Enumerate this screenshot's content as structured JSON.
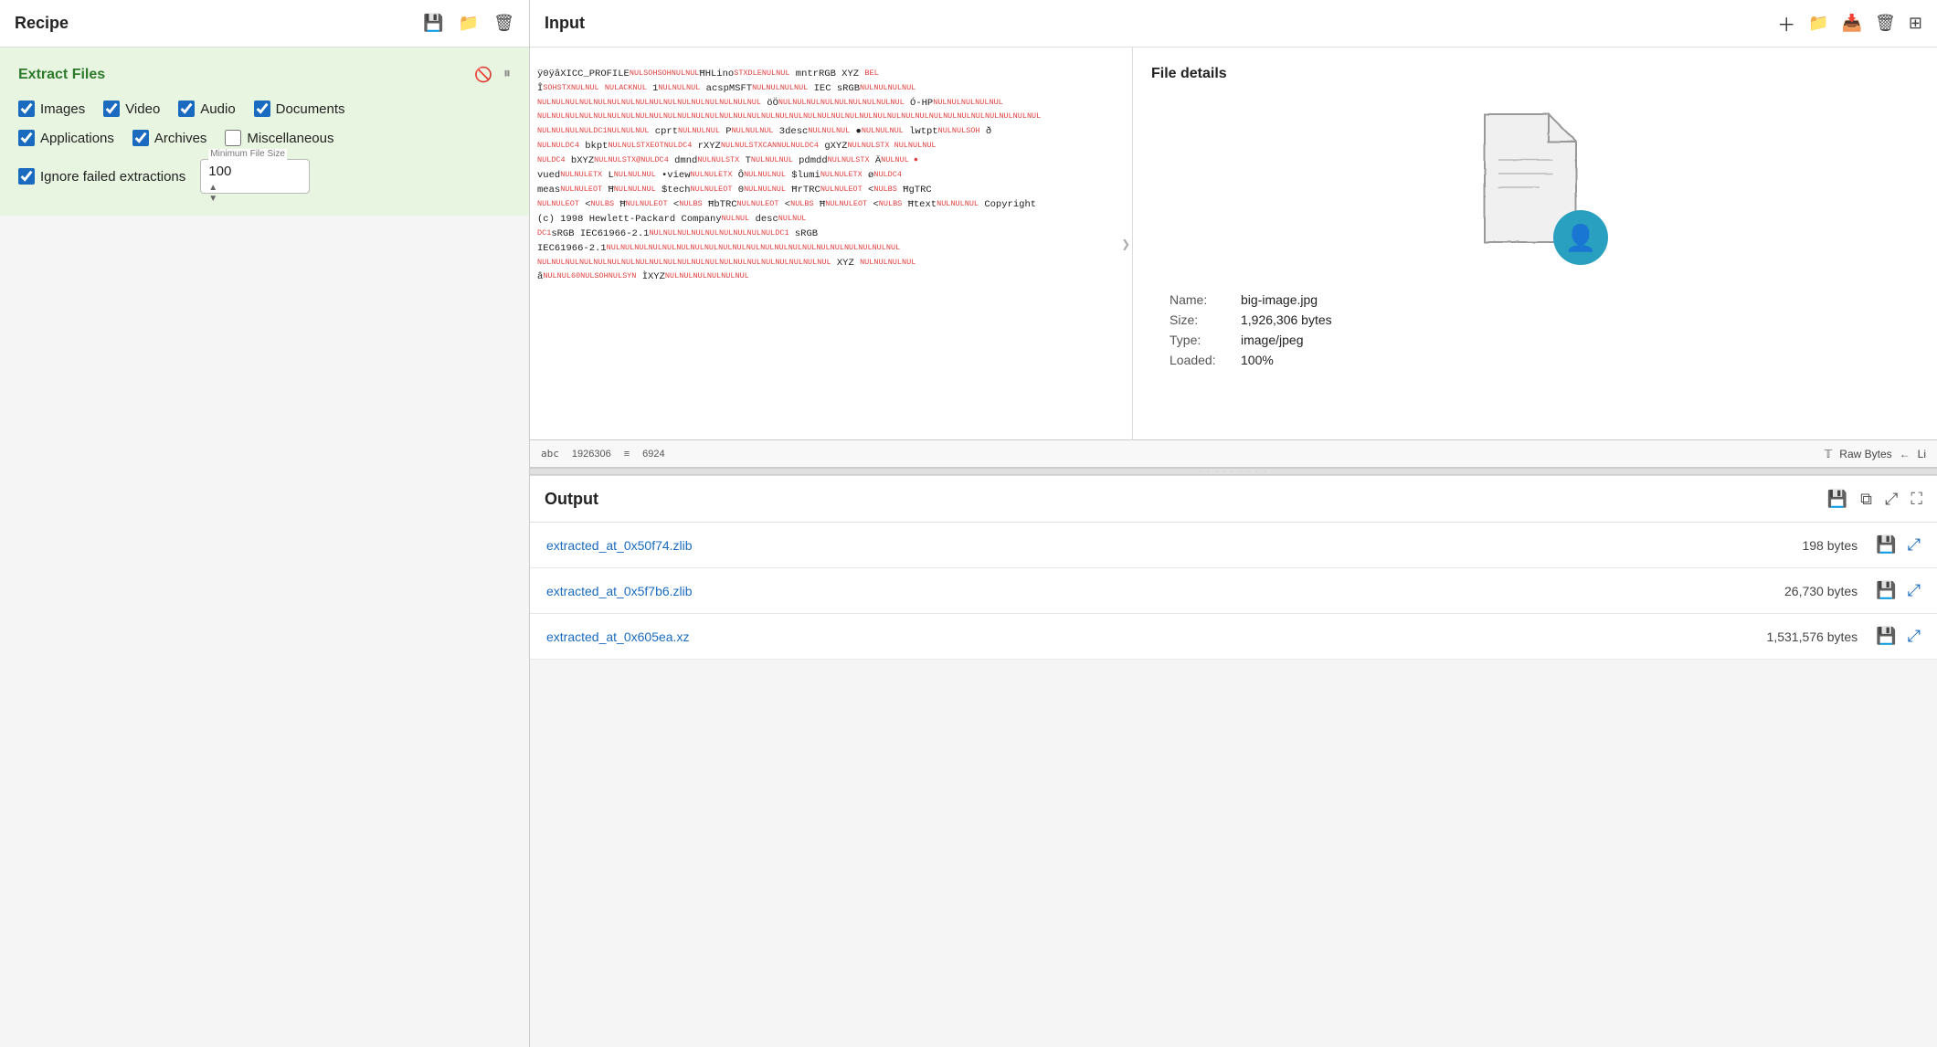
{
  "left_panel": {
    "title": "Recipe",
    "icons": [
      "save",
      "folder",
      "trash"
    ],
    "extract_files": {
      "title": "Extract Files",
      "checkboxes_row1": [
        {
          "label": "Images",
          "checked": true
        },
        {
          "label": "Video",
          "checked": true
        },
        {
          "label": "Audio",
          "checked": true
        },
        {
          "label": "Documents",
          "checked": true
        }
      ],
      "checkboxes_row2": [
        {
          "label": "Applications",
          "checked": true
        },
        {
          "label": "Archives",
          "checked": true
        },
        {
          "label": "Miscellaneous",
          "checked": false
        }
      ],
      "ignore_failed": {
        "label": "Ignore failed extractions",
        "checked": true
      },
      "min_file_size": {
        "label": "Minimum File Size",
        "value": "100"
      }
    }
  },
  "right_panel": {
    "input_title": "Input",
    "input_icons": [
      "plus",
      "folder",
      "import",
      "trash",
      "grid"
    ],
    "file_details": {
      "title": "File details",
      "name_label": "Name:",
      "name_value": "big-image.jpg",
      "size_label": "Size:",
      "size_value": "1,926,306 bytes",
      "type_label": "Type:",
      "type_value": "image/jpeg",
      "loaded_label": "Loaded:",
      "loaded_value": "100%"
    },
    "hex_footer": {
      "abc_value": "1926306",
      "lines_value": "6924"
    },
    "hex_mode": {
      "raw_bytes": "Raw Bytes",
      "li": "Li"
    },
    "output_title": "Output",
    "output_icons": [
      "save",
      "copy",
      "expand",
      "fullscreen"
    ],
    "output_items": [
      {
        "filename": "extracted_at_0x50f74.zlib",
        "size": "198 bytes"
      },
      {
        "filename": "extracted_at_0x5f7b6.zlib",
        "size": "26,730 bytes"
      },
      {
        "filename": "extracted_at_0x605ea.xz",
        "size": "1,531,576 bytes"
      }
    ]
  }
}
